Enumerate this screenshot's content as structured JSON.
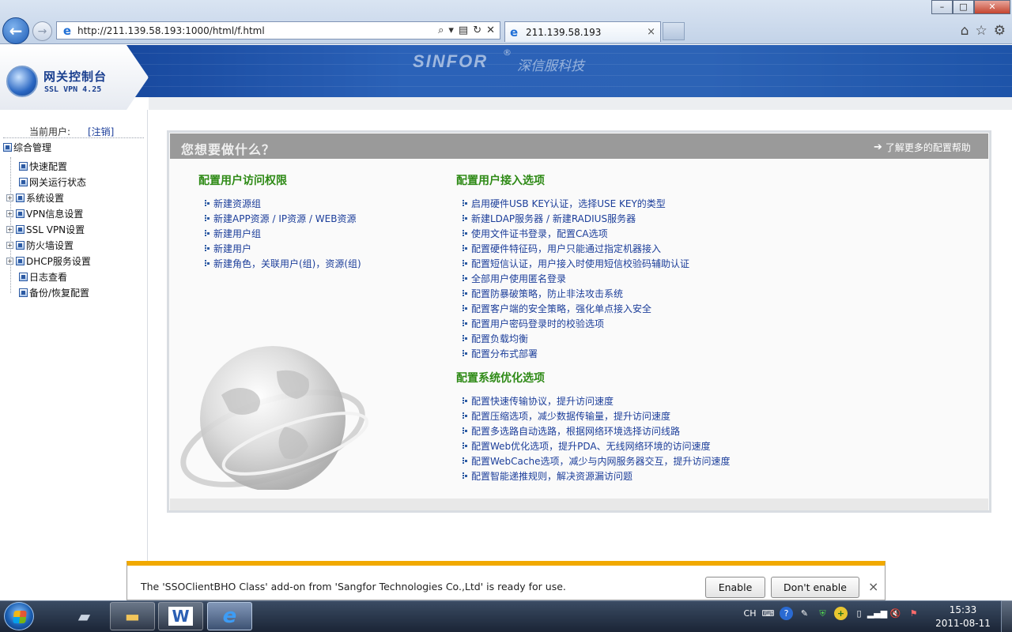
{
  "browser": {
    "window_buttons": {
      "minimize": "–",
      "maximize": "□",
      "close": "✕"
    },
    "address_url": "http://211.139.58.193:1000/html/f.html",
    "tab_title": "211.139.58.193",
    "tab_close": "×"
  },
  "banner": {
    "gateway_title": "网关控制台",
    "ssl_version": "SSL VPN 4.25",
    "brand_name": "SINFOR",
    "brand_reg": "®",
    "brand_cn": "深信服科技"
  },
  "sidebar": {
    "current_user_label": "当前用户:",
    "logout_link": "[注销]",
    "root_label": "综合管理",
    "items": [
      {
        "label": "快速配置",
        "expandable": false
      },
      {
        "label": "网关运行状态",
        "expandable": false
      },
      {
        "label": "系统设置",
        "expandable": true
      },
      {
        "label": "VPN信息设置",
        "expandable": true
      },
      {
        "label": "SSL VPN设置",
        "expandable": true
      },
      {
        "label": "防火墙设置",
        "expandable": true
      },
      {
        "label": "DHCP服务设置",
        "expandable": true
      },
      {
        "label": "日志查看",
        "expandable": false
      },
      {
        "label": "备份/恢复配置",
        "expandable": false
      }
    ]
  },
  "panel": {
    "title": "您想要做什么？",
    "help_link": "了解更多的配置帮助",
    "sections": [
      {
        "title": "配置用户访问权限",
        "links": [
          "新建资源组",
          "新建APP资源 / IP资源 / WEB资源",
          "新建用户组",
          "新建用户",
          "新建角色，关联用户(组)，资源(组)"
        ]
      },
      {
        "title": "配置用户接入选项",
        "links": [
          "启用硬件USB KEY认证，选择USE KEY的类型",
          "新建LDAP服务器 / 新建RADIUS服务器",
          "使用文件证书登录，配置CA选项",
          "配置硬件特征码，用户只能通过指定机器接入",
          "配置短信认证，用户接入时使用短信校验码辅助认证",
          "全部用户使用匿名登录",
          "配置防暴破策略，防止非法攻击系统",
          "配置客户端的安全策略，强化单点接入安全",
          "配置用户密码登录时的校验选项",
          "配置负载均衡",
          "配置分布式部署"
        ]
      },
      {
        "title": "配置系统优化选项",
        "links": [
          "配置快速传输协议，提升访问速度",
          "配置压缩选项，减少数据传输量，提升访问速度",
          "配置多选路自动选路，根据网络环境选择访问线路",
          "配置Web优化选项，提升PDA、无线网络环境的访问速度",
          "配置WebCache选项，减少与内网服务器交互，提升访问速度",
          "配置智能递推规则，解决资源漏访问题"
        ]
      }
    ]
  },
  "notification": {
    "message": "The 'SSOClientBHO Class' add-on from 'Sangfor Technologies Co.,Ltd' is ready for use.",
    "enable_label": "Enable",
    "dont_enable_label": "Don't enable",
    "close": "×"
  },
  "taskbar": {
    "tray_lang": "CH",
    "clock_time": "15:33",
    "clock_date": "2011-08-11"
  },
  "colors": {
    "banner_blue": "#2b62b8",
    "section_green": "#2e8a16",
    "link_blue": "#1c3e9a",
    "panel_header_gray": "#9a9a9a",
    "notify_accent": "#f1a900"
  }
}
